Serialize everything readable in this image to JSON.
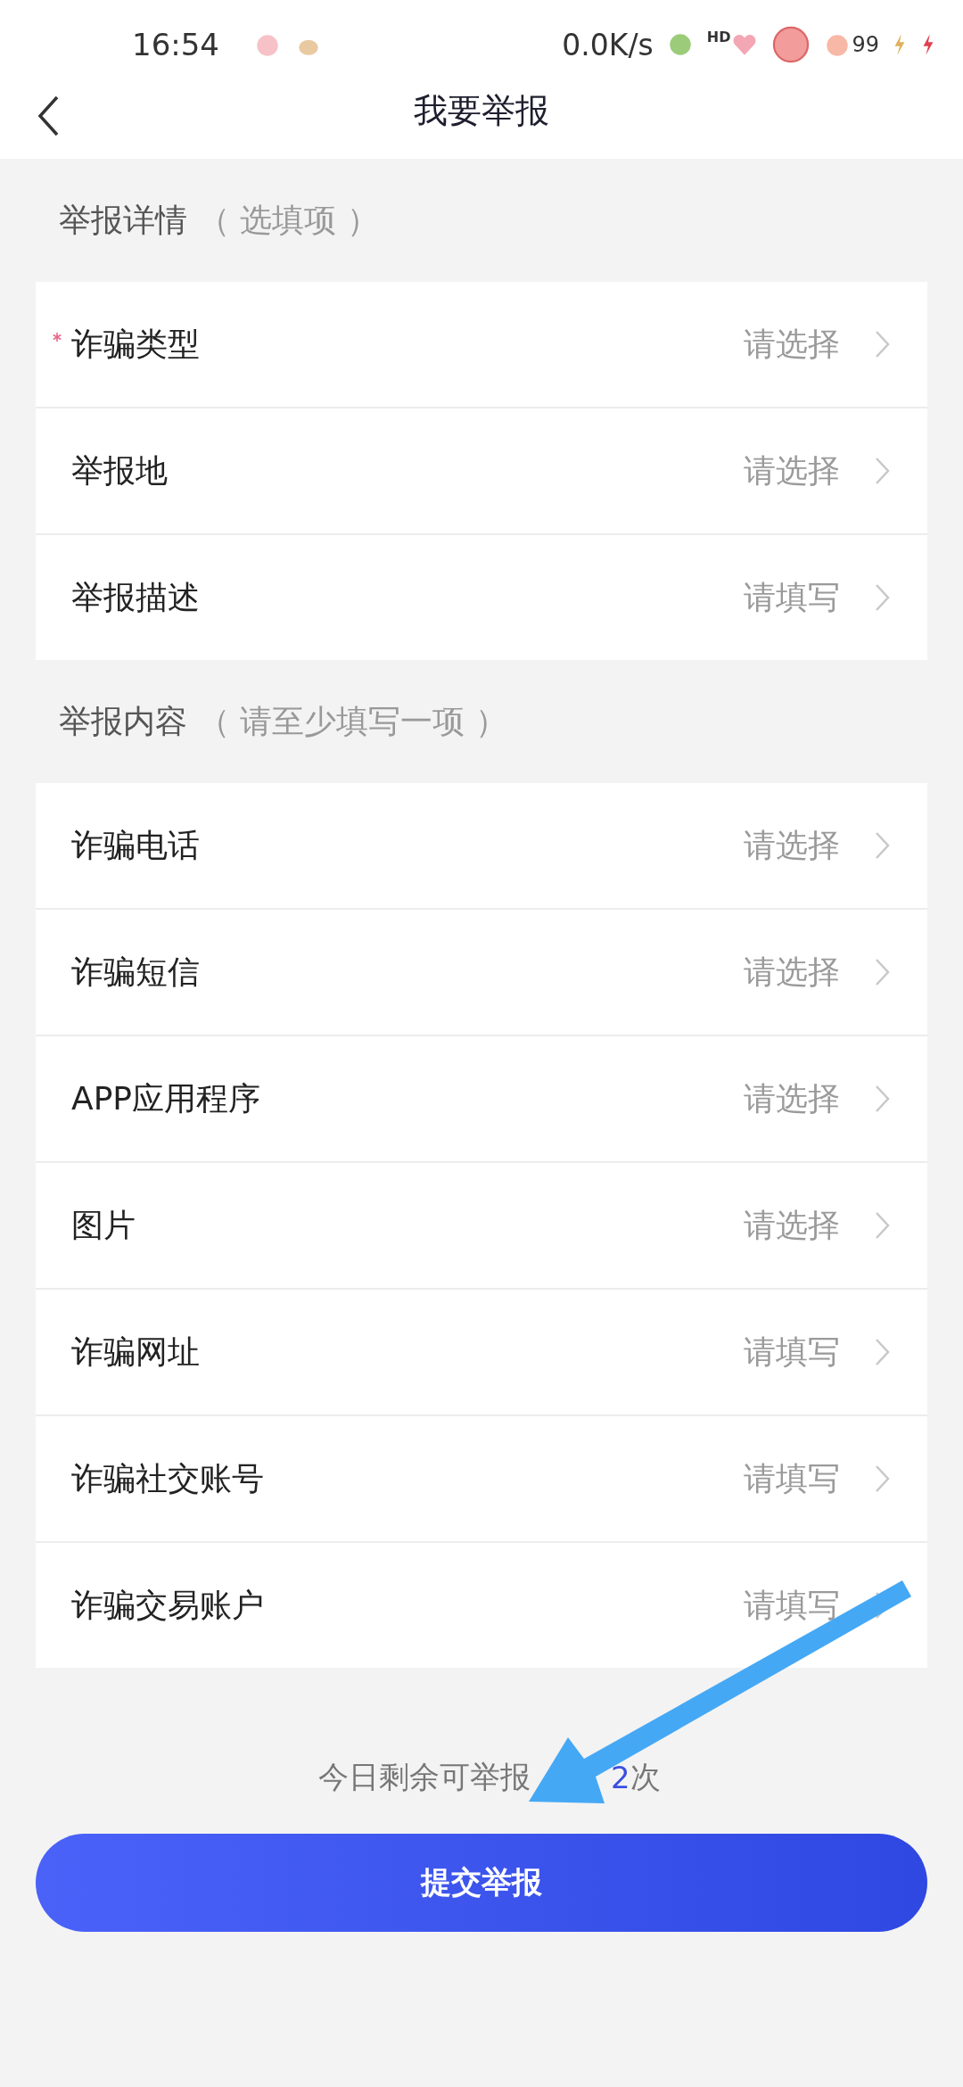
{
  "status_bar": {
    "time": "16:54",
    "speed": "0.0K/s",
    "hd": "HD",
    "battery": "99"
  },
  "header": {
    "title": "我要举报"
  },
  "sections": [
    {
      "title": "举报详情",
      "hint": "（ 选填项 ）",
      "rows": [
        {
          "label": "诈骗类型",
          "required": true,
          "value": "请选择"
        },
        {
          "label": "举报地",
          "required": false,
          "value": "请选择"
        },
        {
          "label": "举报描述",
          "required": false,
          "value": "请填写"
        }
      ]
    },
    {
      "title": "举报内容",
      "hint": "（ 请至少填写一项 ）",
      "rows": [
        {
          "label": "诈骗电话",
          "required": false,
          "value": "请选择"
        },
        {
          "label": "诈骗短信",
          "required": false,
          "value": "请选择"
        },
        {
          "label": "APP应用程序",
          "required": false,
          "value": "请选择"
        },
        {
          "label": "图片",
          "required": false,
          "value": "请选择"
        },
        {
          "label": "诈骗网址",
          "required": false,
          "value": "请填写"
        },
        {
          "label": "诈骗社交账号",
          "required": false,
          "value": "请填写"
        },
        {
          "label": "诈骗交易账户",
          "required": false,
          "value": "请填写"
        }
      ]
    }
  ],
  "remaining": {
    "prefix": "今日剩余可举报",
    "count": "2",
    "suffix": "次"
  },
  "submit": "提交举报"
}
